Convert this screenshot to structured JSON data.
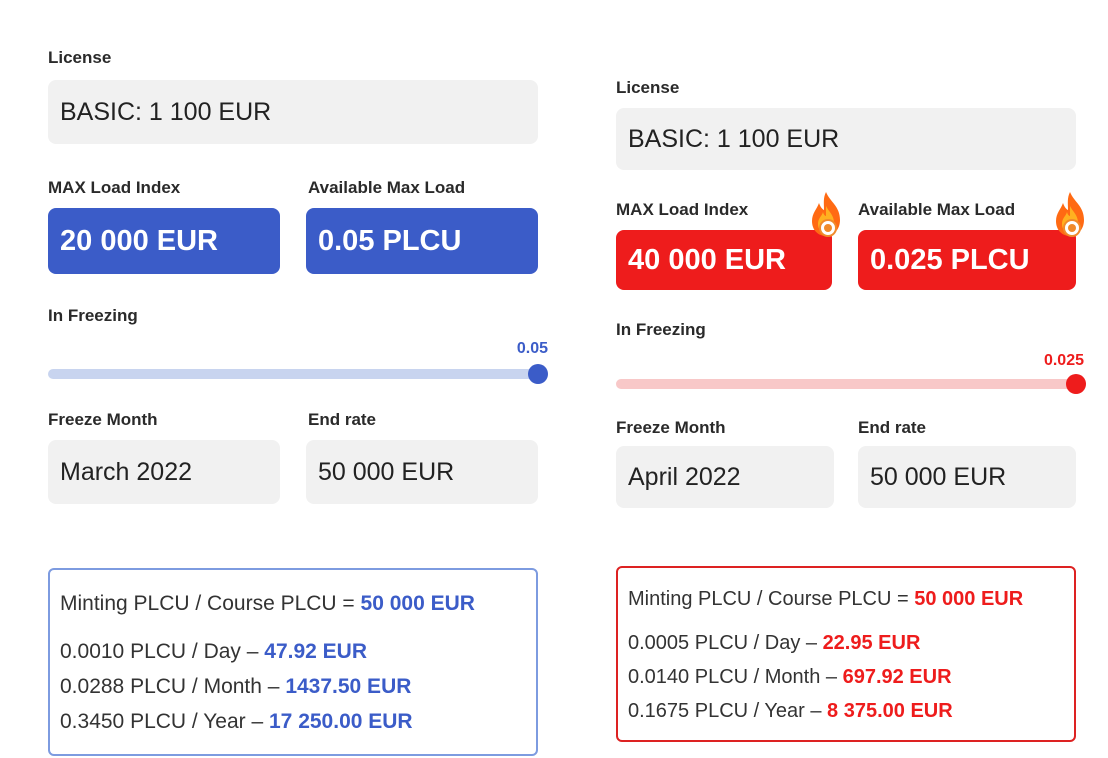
{
  "colors": {
    "blue": "#3b5cc8",
    "blue_light": "#c8d4ef",
    "red": "#ee1c1c",
    "red_light": "#f8c8c8",
    "field_bg": "#f1f1f1"
  },
  "left": {
    "license_label": "License",
    "license_value": "BASIC: 1 100 EUR",
    "max_load_label": "MAX Load Index",
    "max_load_value": "20 000 EUR",
    "available_label": "Available Max Load",
    "available_value": "0.05 PLCU",
    "freezing_label": "In Freezing",
    "slider_value_text": "0.05",
    "slider_fraction": 1.0,
    "freeze_month_label": "Freeze Month",
    "freeze_month_value": "March 2022",
    "end_rate_label": "End rate",
    "end_rate_value": "50 000 EUR",
    "minting_prefix": "Minting PLCU / Course PLCU = ",
    "minting_value": "50 000 EUR",
    "rows": [
      {
        "prefix": "0.0010 PLCU / Day – ",
        "value": "47.92 EUR"
      },
      {
        "prefix": "0.0288 PLCU / Month – ",
        "value": "1437.50 EUR"
      },
      {
        "prefix": "0.3450 PLCU / Year – ",
        "value": "17 250.00 EUR"
      }
    ]
  },
  "right": {
    "license_label": "License",
    "license_value": "BASIC: 1 100 EUR",
    "max_load_label": "MAX Load Index",
    "max_load_value": "40 000 EUR",
    "available_label": "Available Max Load",
    "available_value": "0.025 PLCU",
    "freezing_label": "In Freezing",
    "slider_value_text": "0.025",
    "slider_fraction": 1.0,
    "freeze_month_label": "Freeze Month",
    "freeze_month_value": "April 2022",
    "end_rate_label": "End rate",
    "end_rate_value": "50 000 EUR",
    "minting_prefix": "Minting PLCU / Course PLCU = ",
    "minting_value": "50 000 EUR",
    "rows": [
      {
        "prefix": "0.0005 PLCU / Day – ",
        "value": "22.95 EUR"
      },
      {
        "prefix": "0.0140 PLCU / Month – ",
        "value": "697.92 EUR"
      },
      {
        "prefix": "0.1675 PLCU / Year – ",
        "value": "8 375.00 EUR"
      }
    ],
    "badge_icon": "fire-icon"
  }
}
